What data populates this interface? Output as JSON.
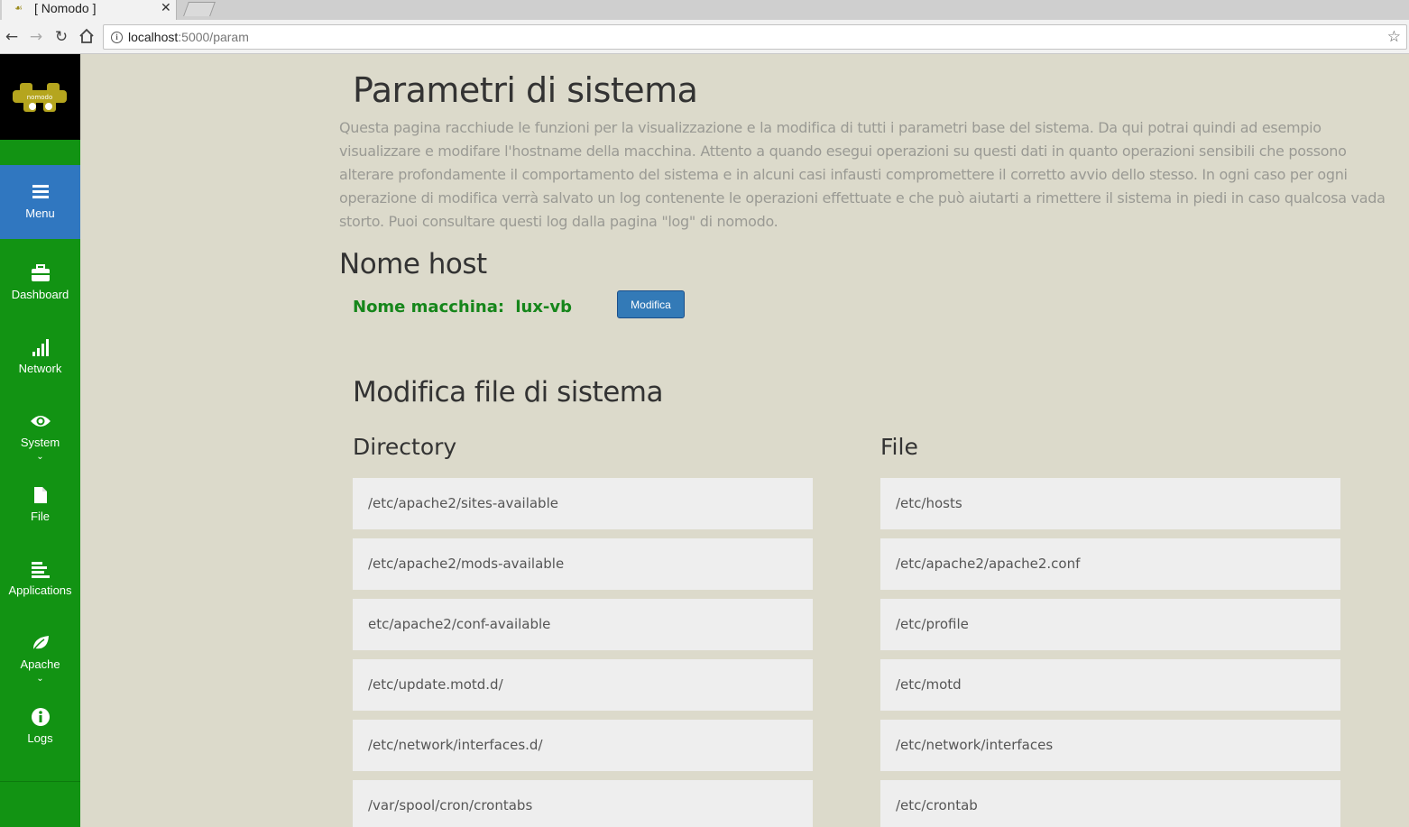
{
  "browser": {
    "tab_title": "[ Nomodo ]",
    "url_host": "localhost",
    "url_path": ":5000/param"
  },
  "sidebar": {
    "items": [
      {
        "label": "Menu",
        "icon": "bars-icon",
        "active": true
      },
      {
        "label": "Dashboard",
        "icon": "briefcase-icon"
      },
      {
        "label": "Network",
        "icon": "signal-icon"
      },
      {
        "label": "System",
        "icon": "eye-icon",
        "has_submenu": true
      },
      {
        "label": "File",
        "icon": "file-icon"
      },
      {
        "label": "Applications",
        "icon": "align-left-icon"
      },
      {
        "label": "Apache",
        "icon": "leaf-icon",
        "has_submenu": true
      },
      {
        "label": "Logs",
        "icon": "info-circle-icon"
      }
    ],
    "logo_text": "nomodo"
  },
  "main": {
    "title": "Parametri di sistema",
    "intro": "Questa pagina racchiude le funzioni per la visualizzazione e la modifica di tutti i parametri base del sistema. Da qui potrai quindi ad esempio visualizzare e modifare l'hostname della macchina. Attento a quando esegui operazioni su questi dati in quanto operazioni sensibili che possono alterare profondamente il comportamento del sistema e in alcuni casi infausti compromettere il corretto avvio dello stesso. In ogni caso per ogni operazione di modifica verrà salvato un log contenente le operazioni effettuate e che può aiutarti a rimettere il sistema in piedi in caso qualcosa vada storto. Puoi consultare questi log dalla pagina \"log\" di nomodo.",
    "hostname_section": "Nome host",
    "hostname_label": "Nome macchina:",
    "hostname_value": "lux-vb",
    "modify_button": "Modifica",
    "files_section": "Modifica file di sistema",
    "directory_title": "Directory",
    "file_title": "File",
    "directories": [
      "/etc/apache2/sites-available",
      "/etc/apache2/mods-available",
      "etc/apache2/conf-available",
      "/etc/update.motd.d/",
      "/etc/network/interfaces.d/",
      "/var/spool/cron/crontabs"
    ],
    "files": [
      "/etc/hosts",
      "/etc/apache2/apache2.conf",
      "/etc/profile",
      "/etc/motd",
      "/etc/network/interfaces",
      "/etc/crontab"
    ]
  },
  "colors": {
    "sidebar_green": "#129313",
    "active_blue": "#3077c0",
    "page_bg": "#dcdacb",
    "host_green": "#16861b",
    "button_blue": "#337ab7"
  }
}
